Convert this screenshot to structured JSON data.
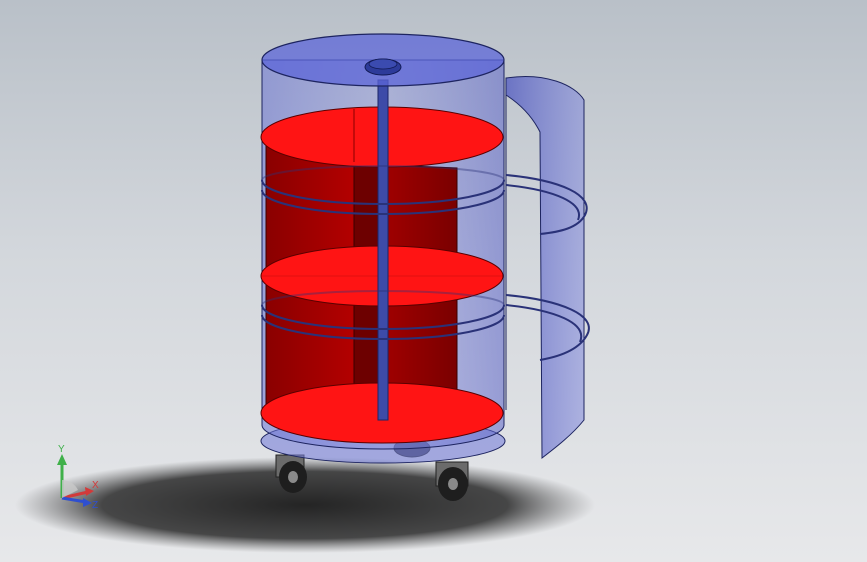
{
  "viewport": {
    "background_top": "#b9c0c8",
    "background_bottom": "#e7e8ea"
  },
  "model": {
    "shell_color": "#6f78d8",
    "shelf_color": "#ff1414",
    "shaft_color": "#3d4ba8",
    "caster_color": "#2a2a2a"
  },
  "triad": {
    "y_label": "Y",
    "x_label": "X",
    "z_label": "Z",
    "y_color": "#3fb04a",
    "x_color": "#d23a3a",
    "z_color": "#2f4fd0"
  }
}
